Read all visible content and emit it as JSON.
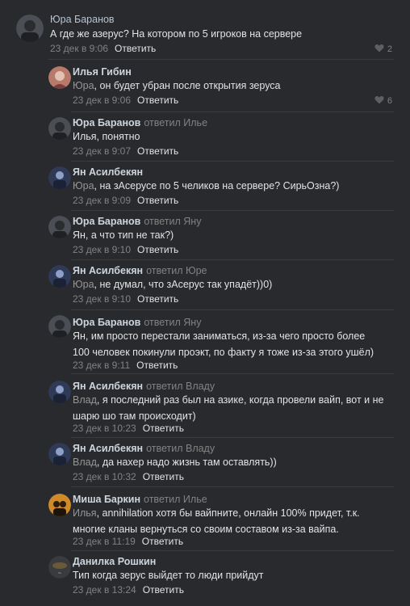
{
  "comments": [
    {
      "author": "Юра Баранов",
      "replied_to": "",
      "mention": "",
      "text": "А где же азерус? На котором по 5 игроков на сервере",
      "date": "23 дек в 9:06",
      "reply": "Ответить",
      "likes": "2",
      "avatar_color": "#4b4f55"
    },
    {
      "author": "Илья Гибин",
      "replied_to": "",
      "mention": "Юра",
      "text": ", он будет убран после открытия зеруса",
      "date": "23 дек в 9:06",
      "reply": "Ответить",
      "likes": "6",
      "avatar_color": "#b87a6a"
    },
    {
      "author": "Юра Баранов",
      "replied_to": "ответил Илье",
      "mention": "",
      "text": "Илья, понятно",
      "date": "23 дек в 9:07",
      "reply": "Ответить",
      "likes": "",
      "avatar_color": "#4b4f55"
    },
    {
      "author": "Ян Асилбекян",
      "replied_to": "",
      "mention": "Юра",
      "text": ", на зАсерусе по 5 челиков на сервере? СирьОзна?)",
      "date": "23 дек в 9:09",
      "reply": "Ответить",
      "likes": "",
      "avatar_color": "#2f3a57"
    },
    {
      "author": "Юра Баранов",
      "replied_to": "ответил Яну",
      "mention": "",
      "text": "Ян, а что тип не так?)",
      "date": "23 дек в 9:10",
      "reply": "Ответить",
      "likes": "",
      "avatar_color": "#4b4f55"
    },
    {
      "author": "Ян Асилбекян",
      "replied_to": "ответил Юре",
      "mention": "Юра",
      "text": ", не думал, что зАсерус так упадёт))0)",
      "date": "23 дек в 9:10",
      "reply": "Ответить",
      "likes": "",
      "avatar_color": "#2f3a57"
    },
    {
      "author": "Юра Баранов",
      "replied_to": "ответил Яну",
      "mention": "",
      "text": "Ян, им просто перестали заниматься, из-за чего просто более 100 человек покинули проэкт, по факту я тоже из-за этого ушёл)",
      "date": "23 дек в 9:11",
      "reply": "Ответить",
      "likes": "",
      "avatar_color": "#4b4f55"
    },
    {
      "author": "Ян Асилбекян",
      "replied_to": "ответил Владу",
      "mention": "Влад",
      "text": ", я последний раз был на азике, когда провели вайп, вот и не шарю шо там происходит)",
      "date": "23 дек в 10:23",
      "reply": "Ответить",
      "likes": "",
      "avatar_color": "#2f3a57"
    },
    {
      "author": "Ян Асилбекян",
      "replied_to": "ответил Владу",
      "mention": "Влад",
      "text": ", да нахер надо жизнь там оставлять))",
      "date": "23 дек в 10:32",
      "reply": "Ответить",
      "likes": "",
      "avatar_color": "#2f3a57"
    },
    {
      "author": "Миша Баркин",
      "replied_to": "ответил Илье",
      "mention": "Илья",
      "text": ", annihilation хотя бы вайпните, онлайн 100% придет, т.к. многие кланы вернуться со своим составом из-за вайпа.",
      "date": "23 дек в 11:19",
      "reply": "Ответить",
      "likes": "",
      "avatar_color": "#d08a2a"
    },
    {
      "author": "Данилка Рошкин",
      "replied_to": "",
      "mention": "",
      "text": "Тип когда зерус выйдет то люди прийдут",
      "date": "23 дек в 13:24",
      "reply": "Ответить",
      "likes": "",
      "avatar_color": "#3a3b3e"
    }
  ]
}
